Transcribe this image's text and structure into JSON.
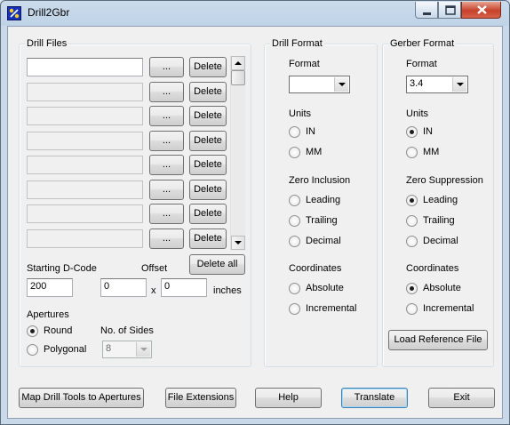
{
  "window": {
    "title": "Drill2Gbr"
  },
  "drill_files": {
    "legend": "Drill Files",
    "rows": [
      {
        "value": "",
        "browse_label": "...",
        "delete_label": "Delete"
      },
      {
        "value": "",
        "browse_label": "...",
        "delete_label": "Delete"
      },
      {
        "value": "",
        "browse_label": "...",
        "delete_label": "Delete"
      },
      {
        "value": "",
        "browse_label": "...",
        "delete_label": "Delete"
      },
      {
        "value": "",
        "browse_label": "...",
        "delete_label": "Delete"
      },
      {
        "value": "",
        "browse_label": "...",
        "delete_label": "Delete"
      },
      {
        "value": "",
        "browse_label": "...",
        "delete_label": "Delete"
      },
      {
        "value": "",
        "browse_label": "...",
        "delete_label": "Delete"
      }
    ],
    "starting_dcode_label": "Starting D-Code",
    "starting_dcode_value": "200",
    "offset_label": "Offset",
    "offset_x_value": "0",
    "offset_y_value": "0",
    "offset_separator": "x",
    "offset_units": "inches",
    "delete_all_label": "Delete all",
    "apertures_label": "Apertures",
    "aperture_options": [
      {
        "label": "Round",
        "checked": true
      },
      {
        "label": "Polygonal",
        "checked": false
      }
    ],
    "sides_label": "No. of Sides",
    "sides_value": "8"
  },
  "drill_format": {
    "legend": "Drill Format",
    "format_label": "Format",
    "format_value": "",
    "units_label": "Units",
    "units": [
      {
        "label": "IN",
        "checked": false
      },
      {
        "label": "MM",
        "checked": false
      }
    ],
    "zero_label": "Zero Inclusion",
    "zero": [
      {
        "label": "Leading",
        "checked": false
      },
      {
        "label": "Trailing",
        "checked": false
      },
      {
        "label": "Decimal",
        "checked": false
      }
    ],
    "coords_label": "Coordinates",
    "coords": [
      {
        "label": "Absolute",
        "checked": false
      },
      {
        "label": "Incremental",
        "checked": false
      }
    ]
  },
  "gerber_format": {
    "legend": "Gerber Format",
    "format_label": "Format",
    "format_value": "3.4",
    "units_label": "Units",
    "units": [
      {
        "label": "IN",
        "checked": true
      },
      {
        "label": "MM",
        "checked": false
      }
    ],
    "zero_label": "Zero Suppression",
    "zero": [
      {
        "label": "Leading",
        "checked": true
      },
      {
        "label": "Trailing",
        "checked": false
      },
      {
        "label": "Decimal",
        "checked": false
      }
    ],
    "coords_label": "Coordinates",
    "coords": [
      {
        "label": "Absolute",
        "checked": true
      },
      {
        "label": "Incremental",
        "checked": false
      }
    ],
    "load_reference_label": "Load Reference File"
  },
  "bottom_buttons": {
    "map_tools": "Map Drill Tools to Apertures",
    "file_extensions": "File Extensions",
    "help": "Help",
    "translate": "Translate",
    "exit": "Exit"
  }
}
